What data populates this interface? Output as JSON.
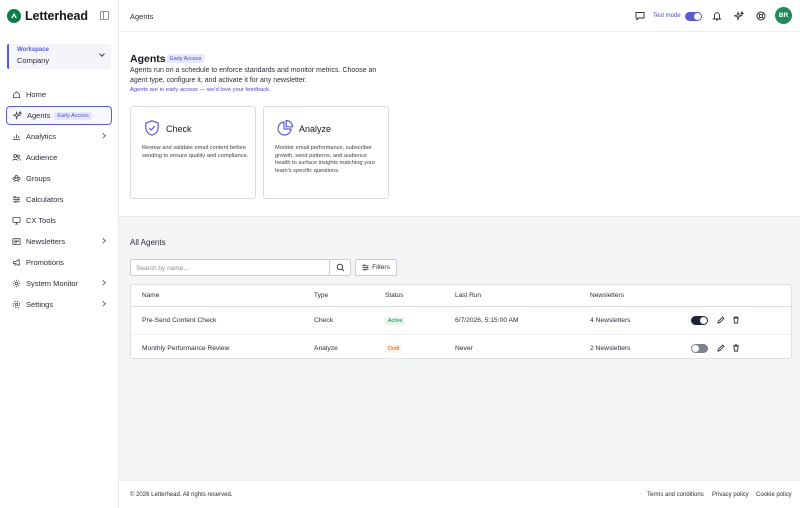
{
  "app": {
    "name": "Letterhead",
    "brand_color": "#0f7a4a",
    "accent_color": "#5b5bd6"
  },
  "sidebar": {
    "workspace": {
      "label": "Workspace",
      "value": "Company"
    },
    "items": [
      {
        "label": "Home",
        "icon": "home-icon",
        "has_chevron": false
      },
      {
        "label": "Agents",
        "icon": "sparkle-icon",
        "badge": "Early Access",
        "active": true,
        "has_chevron": false
      },
      {
        "label": "Analytics",
        "icon": "chart-icon",
        "has_chevron": true
      },
      {
        "label": "Audience",
        "icon": "users-icon",
        "has_chevron": false
      },
      {
        "label": "Groups",
        "icon": "groups-icon",
        "has_chevron": false
      },
      {
        "label": "Calculators",
        "icon": "sliders-icon",
        "has_chevron": false
      },
      {
        "label": "CX Tools",
        "icon": "monitor-icon",
        "has_chevron": false
      },
      {
        "label": "Newsletters",
        "icon": "newsletter-icon",
        "has_chevron": true
      },
      {
        "label": "Promotions",
        "icon": "megaphone-icon",
        "has_chevron": false
      },
      {
        "label": "System Monitor",
        "icon": "settings-gear-icon",
        "has_chevron": true
      },
      {
        "label": "Settings",
        "icon": "gear-icon",
        "has_chevron": true
      }
    ]
  },
  "topbar": {
    "breadcrumb": "Agents",
    "test_mode_label": "Test mode",
    "avatar_initials": "BR"
  },
  "hero": {
    "title": "Agents",
    "badge": "Early Access",
    "description": "Agents run on a schedule to enforce standards and monitor metrics. Choose an agent type, configure it, and activate it for any newsletter.",
    "note": "Agents are in early access — we'd love your feedback.",
    "cards": [
      {
        "title": "Check",
        "icon": "shield-check-icon",
        "description": "Review and validate email content before sending to ensure quality and compliance."
      },
      {
        "title": "Analyze",
        "icon": "pie-chart-icon",
        "description": "Monitor email performance, subscriber growth, send patterns, and audience health to surface insights matching your team's specific questions."
      }
    ]
  },
  "agents": {
    "section_title": "All Agents",
    "search_placeholder": "Search by name...",
    "filters_label": "Filters",
    "columns": [
      "Name",
      "Type",
      "Status",
      "Last Run",
      "Newsletters"
    ],
    "rows": [
      {
        "name": "Pre-Send Content Check",
        "type": "Check",
        "status": "Active",
        "last_run": "6/7/2026, 5:15:00 AM",
        "newsletters": "4 Newsletters",
        "enabled": true
      },
      {
        "name": "Monthly Performance Review",
        "type": "Analyze",
        "status": "Draft",
        "last_run": "Never",
        "newsletters": "2 Newsletters",
        "enabled": false
      }
    ]
  },
  "footer": {
    "copyright": "© 2026 Letterhead. All rights reserved.",
    "links": [
      "Terms and conditions",
      "Privacy policy",
      "Cookie policy"
    ]
  }
}
